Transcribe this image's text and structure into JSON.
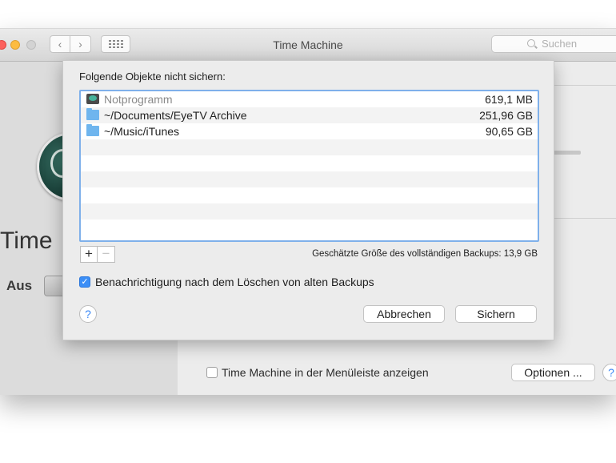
{
  "window": {
    "title": "Time Machine",
    "search_placeholder": "Suchen"
  },
  "background_pane": {
    "app_name": "Time",
    "switch_label": "Aus",
    "menubar_checkbox_label": "Time Machine in der Menüleiste anzeigen",
    "menubar_checked": false,
    "options_button": "Optionen ...",
    "help": "?"
  },
  "sheet": {
    "heading": "Folgende Objekte nicht sichern:",
    "items": [
      {
        "name": "Notprogramm",
        "size": "619,1 MB",
        "icon": "drive-icon"
      },
      {
        "name": "~/Documents/EyeTV Archive",
        "size": "251,96 GB",
        "icon": "folder-icon"
      },
      {
        "name": "~/Music/iTunes",
        "size": "90,65 GB",
        "icon": "folder-icon"
      }
    ],
    "add_button": "+",
    "remove_button": "−",
    "estimate": "Geschätzte Größe des vollständigen Backups: 13,9 GB",
    "notify_label": "Benachrichtigung nach dem Löschen von alten Backups",
    "notify_checked": true,
    "help": "?",
    "cancel_button": "Abbrechen",
    "save_button": "Sichern"
  },
  "colors": {
    "accent": "#3b8ef6",
    "list_focus_border": "#7fb0ea",
    "folder": "#6fb5ee"
  }
}
